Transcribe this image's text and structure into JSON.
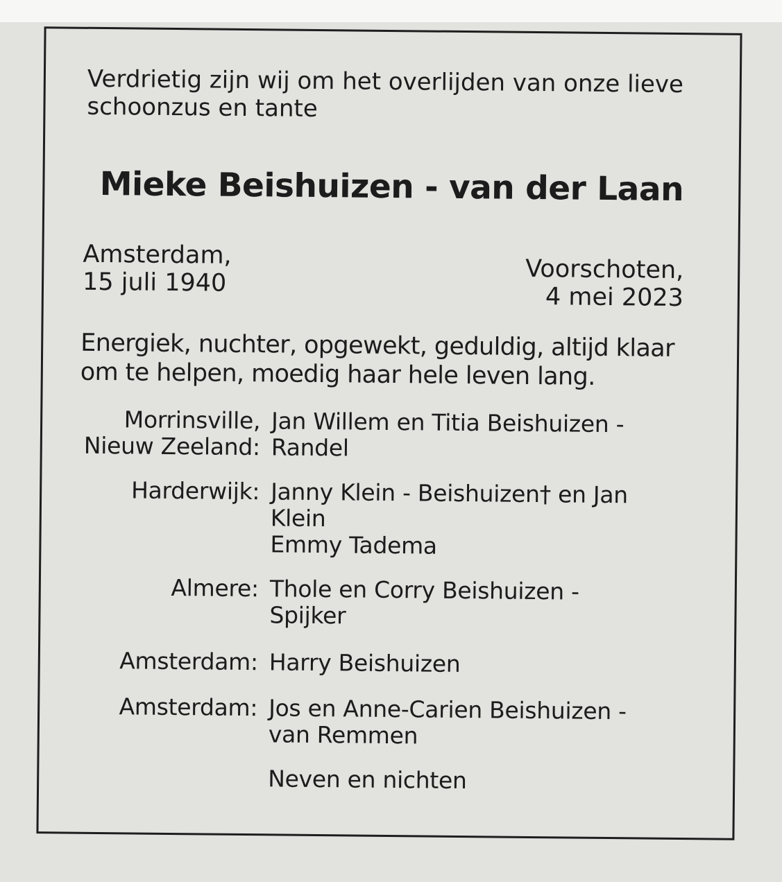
{
  "notice": {
    "intro_lines": [
      "Verdrietig zijn wij om het overlijden van onze lieve",
      "schoonzus en tante"
    ],
    "name": "Mieke Beishuizen - van der Laan",
    "birth": {
      "place": "Amsterdam,",
      "date": "15 juli 1940"
    },
    "death": {
      "place": "Voorschoten,",
      "date": "4 mei 2023"
    },
    "tribute_lines": [
      "Energiek, nuchter, opgewekt, geduldig, altijd klaar",
      "om te helpen, moedig haar hele leven lang."
    ],
    "families": [
      {
        "place_lines": [
          "Morrinsville,",
          "Nieuw Zeeland:"
        ],
        "name_lines": [
          "Jan Willem en Titia Beishuizen -",
          "Randel"
        ]
      },
      {
        "place_lines": [
          "Harderwijk:"
        ],
        "name_lines": [
          "Janny Klein - Beishuizen† en Jan",
          "Klein",
          "Emmy Tadema"
        ]
      },
      {
        "place_lines": [
          "Almere:"
        ],
        "name_lines": [
          "Thole en Corry Beishuizen -",
          "Spijker"
        ]
      },
      {
        "place_lines": [
          "Amsterdam:"
        ],
        "name_lines": [
          "Harry Beishuizen"
        ]
      },
      {
        "place_lines": [
          "Amsterdam:"
        ],
        "name_lines": [
          "Jos en Anne-Carien Beishuizen -",
          "van Remmen"
        ]
      },
      {
        "place_lines": [],
        "name_lines": [
          "Neven en nichten"
        ]
      }
    ]
  }
}
